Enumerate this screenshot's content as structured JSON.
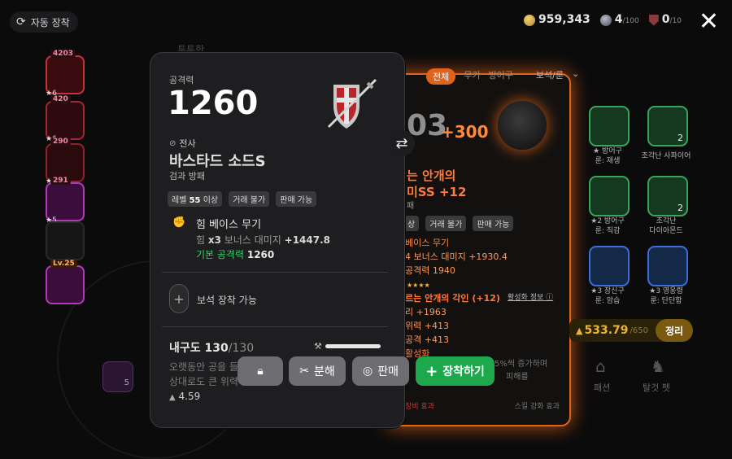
{
  "topbar": {
    "auto_equip_label": "자동 장착",
    "gold": "959,343",
    "gem_current": "4",
    "gem_max": "/100",
    "emblem_current": "0",
    "emblem_max": "/10"
  },
  "left_list": [
    {
      "count": "4203",
      "stars": "★6"
    },
    {
      "count": "420",
      "stars": "★6"
    },
    {
      "count": "290",
      "stars": "★6"
    },
    {
      "count": "291",
      "stars": "★5"
    },
    {
      "count": "",
      "stars": ""
    },
    {
      "count": "Lv.25",
      "stars": ""
    }
  ],
  "back_card": {
    "tabs": [
      "전체",
      "무기",
      "방어구",
      "보석/룬"
    ],
    "attack_partial": "03",
    "attack_bonus": "+300",
    "name_line1": "는 안개의",
    "name_line2": "미SS +12",
    "name_sub": "패",
    "tags": [
      "상",
      "거래 불가",
      "판매 가능"
    ],
    "base_weapon": "베이스 무기",
    "bonus_line": "4 보너스 대미지 +1930.4",
    "base_attack": "공격력 1940",
    "engrave_title": "르는 안개의 각인 (+12)",
    "activation_info": "활성화 정보",
    "e1": "리 +1963",
    "e2": "위력 +413",
    "e3": "공격 +413",
    "activated": "활성화",
    "note1": "5%씩 증가하며",
    "note2": "피해를",
    "footer_left": "장비 효과",
    "footer_right": "스킬 강화 효과"
  },
  "right_panel": {
    "items": [
      {
        "label1": "★ 방어구",
        "label2": "룬: 재생",
        "count": ""
      },
      {
        "label1": "조각난 사파이어",
        "label2": "",
        "count": "2"
      },
      {
        "label1": "★2 방어구",
        "label2": "룬: 직감",
        "count": ""
      },
      {
        "label1": "조각난",
        "label2": "다이아몬드",
        "count": "2"
      },
      {
        "label1": "★3 장신구",
        "label2": "룬: 암습",
        "count": ""
      },
      {
        "label1": "★3 영웅령",
        "label2": "룬: 단단함",
        "count": ""
      }
    ],
    "durability_value": "533.79",
    "durability_max": "/650",
    "sort_label": "정리",
    "bottom_labels": [
      "패션",
      "탈것 펫"
    ]
  },
  "item": {
    "attack_label": "공격력",
    "attack_value": "1260",
    "class_label": "전사",
    "name": "바스타드 소드S",
    "subtitle": "검과 방패",
    "tags": [
      "레벨 55 이상",
      "거래 불가",
      "판매 가능"
    ],
    "level_tag_prefix": "레벨 ",
    "level_tag_num": "55",
    "level_tag_suffix": " 이상",
    "base_title": "힘 베이스 무기",
    "stat_prefix": "힘 ",
    "stat_mult": "x3",
    "stat_mid": " 보너스 대미지 ",
    "stat_value": "+1447.8",
    "base_attack_label": "기본 공격력",
    "base_attack_value": "1260",
    "gem_label": "보석 장착 가능",
    "durability_label": "내구도",
    "durability_value": "130",
    "durability_max": "/130",
    "desc_line1": "오랫동안 공을 들",
    "desc_line2": "상대로도 큰 위력",
    "weight": "4.59",
    "header_partial": "투투한"
  },
  "buttons": {
    "disassemble": "분해",
    "sell": "판매",
    "equip": "장착하기"
  },
  "colors": {
    "accent_orange": "#e0631d",
    "equip_green": "#1ea84e",
    "base_attack_green": "#2fd16c",
    "bonus_orange": "#ff8a3d"
  }
}
